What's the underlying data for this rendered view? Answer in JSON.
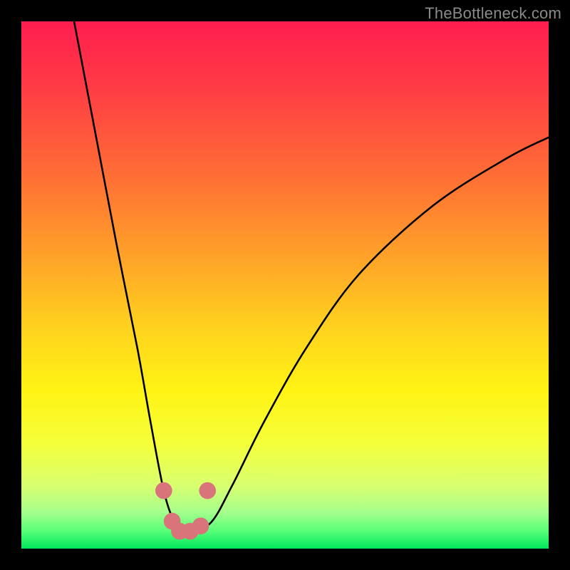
{
  "watermark": "TheBottleneck.com",
  "chart_data": {
    "type": "line",
    "title": "",
    "xlabel": "",
    "ylabel": "",
    "xlim": [
      0,
      100
    ],
    "ylim": [
      0,
      100
    ],
    "series": [
      {
        "name": "bottleneck-curve",
        "x": [
          10,
          14,
          18,
          22,
          24.5,
          27,
          29,
          30.5,
          32,
          36,
          40,
          46,
          54,
          64,
          78,
          92,
          100
        ],
        "y": [
          100,
          79,
          58,
          38,
          24,
          11,
          5,
          3.2,
          3.2,
          5,
          12,
          24,
          38,
          52,
          65,
          74,
          78
        ]
      }
    ],
    "markers": [
      {
        "name": "marker-a",
        "x": 27,
        "y": 11,
        "color": "#d9757a"
      },
      {
        "name": "marker-b",
        "x": 28.6,
        "y": 5.2,
        "color": "#d9757a"
      },
      {
        "name": "marker-c",
        "x": 30,
        "y": 3.3,
        "color": "#d9757a"
      },
      {
        "name": "marker-d",
        "x": 32,
        "y": 3.3,
        "color": "#d9757a"
      },
      {
        "name": "marker-e",
        "x": 34,
        "y": 4.3,
        "color": "#d9757a"
      },
      {
        "name": "marker-f",
        "x": 35.3,
        "y": 11,
        "color": "#d9757a"
      }
    ],
    "gradient_stops": [
      {
        "offset": 0.0,
        "color": "#ff1d4f"
      },
      {
        "offset": 0.12,
        "color": "#ff3a45"
      },
      {
        "offset": 0.28,
        "color": "#ff6a36"
      },
      {
        "offset": 0.44,
        "color": "#ffa029"
      },
      {
        "offset": 0.58,
        "color": "#ffd21e"
      },
      {
        "offset": 0.7,
        "color": "#fff314"
      },
      {
        "offset": 0.8,
        "color": "#f5ff3a"
      },
      {
        "offset": 0.88,
        "color": "#d9ff70"
      },
      {
        "offset": 0.93,
        "color": "#a6ff8c"
      },
      {
        "offset": 0.965,
        "color": "#5cff7a"
      },
      {
        "offset": 1.0,
        "color": "#00e85b"
      }
    ]
  }
}
